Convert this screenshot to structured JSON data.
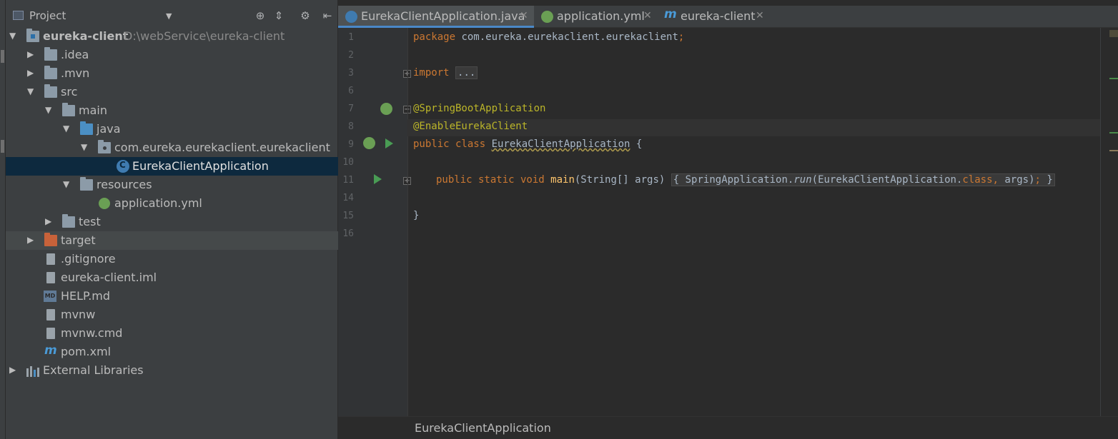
{
  "project": {
    "title": "Project",
    "tree": [
      {
        "label": "eureka-client",
        "path": "D:\\webService\\eureka-client"
      },
      {
        "label": ".idea"
      },
      {
        "label": ".mvn"
      },
      {
        "label": "src"
      },
      {
        "label": "main"
      },
      {
        "label": "java"
      },
      {
        "label": "com.eureka.eurekaclient.eurekaclient"
      },
      {
        "label": "EurekaClientApplication"
      },
      {
        "label": "resources"
      },
      {
        "label": "application.yml"
      },
      {
        "label": "test"
      },
      {
        "label": "target"
      },
      {
        "label": ".gitignore"
      },
      {
        "label": "eureka-client.iml"
      },
      {
        "label": "HELP.md"
      },
      {
        "label": "mvnw"
      },
      {
        "label": "mvnw.cmd"
      },
      {
        "label": "pom.xml"
      },
      {
        "label": "External Libraries"
      }
    ]
  },
  "tabs": [
    {
      "label": "EurekaClientApplication.java"
    },
    {
      "label": "application.yml"
    },
    {
      "label": "eureka-client"
    }
  ],
  "editor": {
    "line_numbers": [
      "1",
      "2",
      "3",
      "6",
      "7",
      "8",
      "9",
      "10",
      "11",
      "14",
      "15",
      "16"
    ],
    "code": {
      "package_kw": "package",
      "package_name": " com.eureka.eurekaclient.eurekaclient",
      "semicolon": ";",
      "import_kw": "import",
      "import_fold": "...",
      "annotation1": "@SpringBootApplication",
      "annotation2": "@EnableEurekaClient",
      "class_mods": "public class ",
      "class_name": "EurekaClientApplication",
      "class_open": " {",
      "main_mods": "public static void ",
      "main_name": "main",
      "main_params": "(String[] args)",
      "body_open": "{",
      "body_call": " SpringApplication.",
      "run_name": "run",
      "run_args_start": "(EurekaClientApplication.",
      "class_kw": "class",
      "comma": ",",
      "run_args_end": " args)",
      "body_close": "}",
      "class_close": "}"
    },
    "breadcrumb": "EurekaClientApplication"
  },
  "colors": {
    "keyword": "#cc7832",
    "annotation": "#bbb529",
    "method": "#ffc66d",
    "text": "#a9b7c6",
    "selection": "#0d293e",
    "accent": "#4a88c7"
  },
  "icons": [
    "project-view-icon",
    "locate-icon",
    "collapse-all-icon",
    "settings-gear-icon",
    "hide-panel-icon",
    "folder-icon",
    "spring-boot-icon",
    "java-class-icon",
    "maven-icon",
    "run-icon",
    "fold-icon"
  ]
}
